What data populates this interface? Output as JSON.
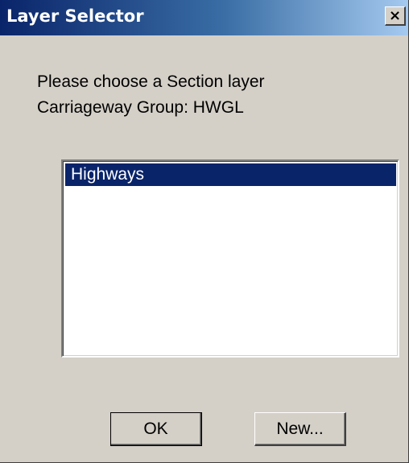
{
  "window": {
    "title": "Layer Selector",
    "close_glyph": "×"
  },
  "prompt": {
    "line1": "Please choose a Section layer",
    "line2": "Carriageway Group: HWGL"
  },
  "layers": {
    "items": [
      {
        "label": "Highways",
        "selected": true
      }
    ]
  },
  "buttons": {
    "ok_label": "OK",
    "new_label": "New..."
  },
  "colors": {
    "title_gradient_start": "#0a246a",
    "title_gradient_end": "#a6caf0",
    "dialog_face": "#d4d0c8",
    "selection": "#0a246a"
  },
  "icons": {
    "close": "close-icon"
  }
}
